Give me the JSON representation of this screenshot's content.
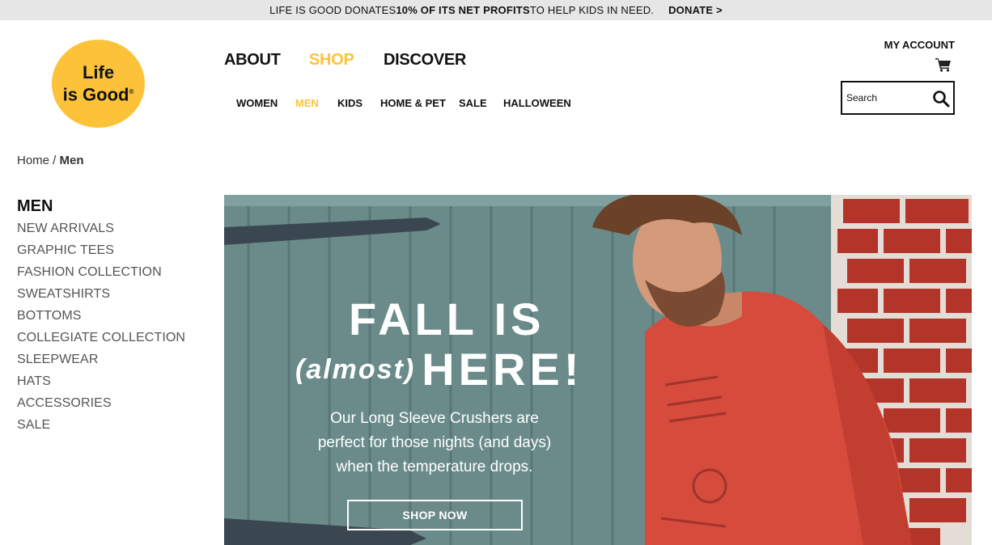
{
  "promo": {
    "text_start": "LIFE IS GOOD DONATES ",
    "text_bold": "10% OF ITS NET PROFITS",
    "text_end": " TO HELP KIDS IN NEED.",
    "donate_label": "DONATE >"
  },
  "logo": {
    "line1": "Life",
    "line2": "is Good",
    "mark": "®"
  },
  "primary_nav": {
    "about": "ABOUT",
    "shop": "SHOP",
    "discover": "DISCOVER"
  },
  "secondary_nav": {
    "items": [
      "WOMEN",
      "MEN",
      "KIDS",
      "HOME & PET",
      "SALE",
      "HALLOWEEN"
    ],
    "active": "MEN"
  },
  "account": {
    "label": "MY ACCOUNT",
    "cart_icon": "cart-icon"
  },
  "search": {
    "placeholder": "Search",
    "icon": "search-icon"
  },
  "breadcrumb": {
    "home": "Home",
    "separator": " / ",
    "current": "Men"
  },
  "sidebar": {
    "title": "MEN",
    "items": [
      "NEW ARRIVALS",
      "GRAPHIC TEES",
      "FASHION COLLECTION",
      "SWEATSHIRTS",
      "BOTTOMS",
      "COLLEGIATE COLLECTION",
      "SLEEPWEAR",
      "HATS",
      "ACCESSORIES",
      "SALE"
    ]
  },
  "hero": {
    "headline_line1": "FALL IS",
    "headline_almost": "(almost)",
    "headline_here": "HERE!",
    "body_line1": "Our Long Sleeve Crushers are",
    "body_line2": "perfect for those nights (and days)",
    "body_line3": "when the temperature drops.",
    "cta": "SHOP NOW"
  },
  "colors": {
    "brand_yellow": "#fcc33a",
    "promo_bg": "#e6e6e6",
    "text": "#111111",
    "sidebar_text": "#555555"
  }
}
